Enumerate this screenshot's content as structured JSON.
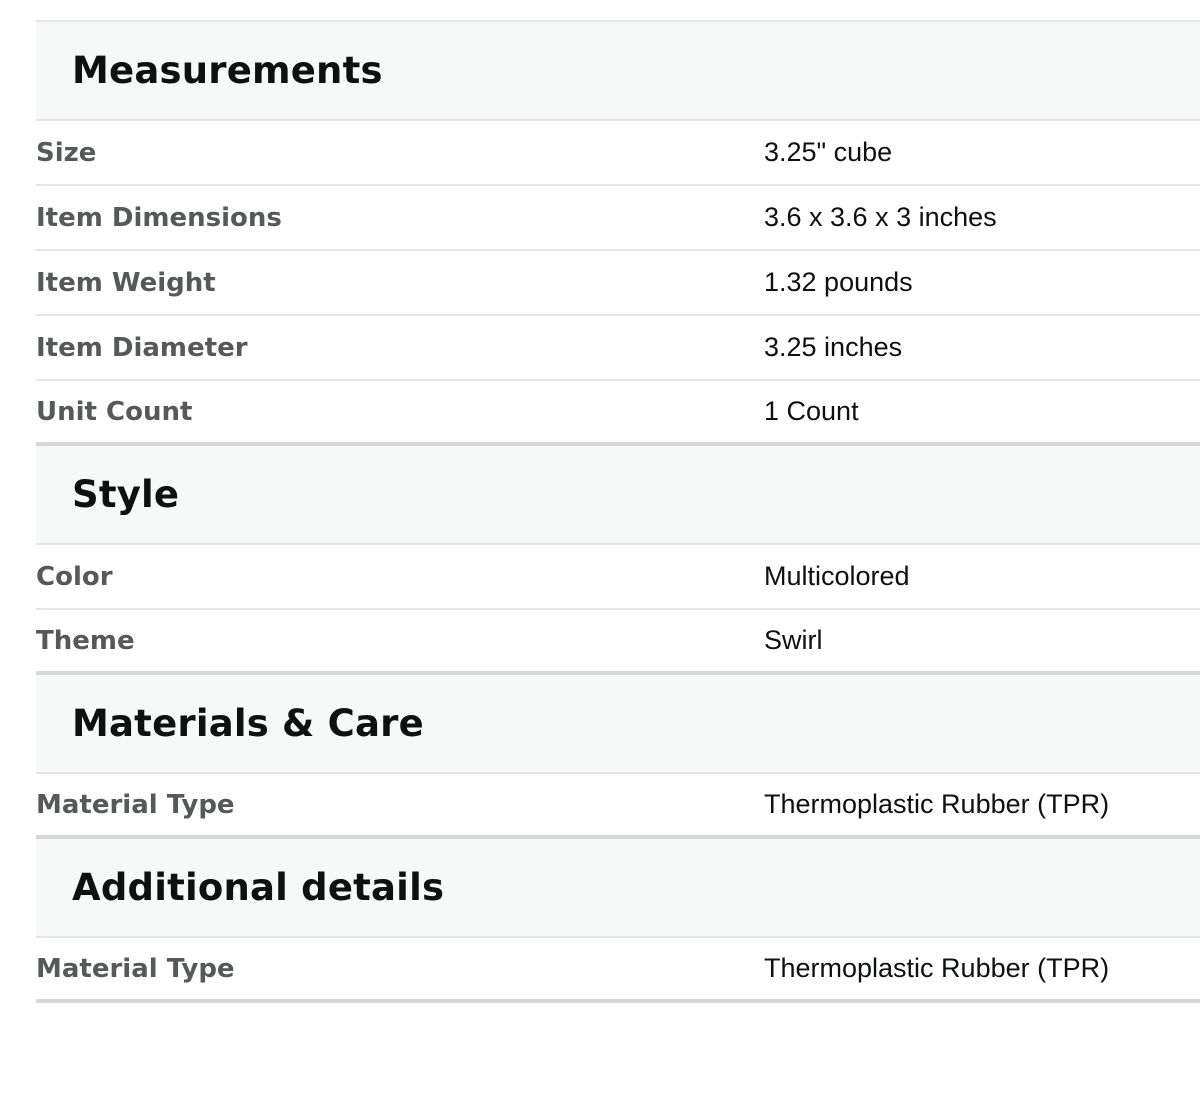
{
  "sections": [
    {
      "title": "Measurements",
      "rows": [
        {
          "label": "Size",
          "value": "3.25\" cube"
        },
        {
          "label": "Item Dimensions",
          "value": "3.6 x 3.6 x 3 inches"
        },
        {
          "label": "Item Weight",
          "value": "1.32 pounds"
        },
        {
          "label": "Item Diameter",
          "value": "3.25 inches"
        },
        {
          "label": "Unit Count",
          "value": "1 Count"
        }
      ]
    },
    {
      "title": "Style",
      "rows": [
        {
          "label": "Color",
          "value": "Multicolored"
        },
        {
          "label": "Theme",
          "value": "Swirl"
        }
      ]
    },
    {
      "title": "Materials & Care",
      "rows": [
        {
          "label": "Material Type",
          "value": "Thermoplastic Rubber (TPR)"
        }
      ]
    },
    {
      "title": "Additional details",
      "rows": [
        {
          "label": "Material Type",
          "value": "Thermoplastic Rubber (TPR)"
        }
      ]
    }
  ]
}
